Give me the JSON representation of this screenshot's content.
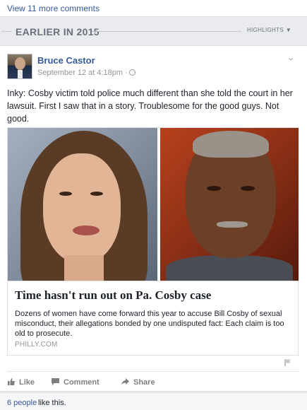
{
  "comments": {
    "view_more_label": "View 11 more comments"
  },
  "section": {
    "title": "EARLIER IN 2015",
    "highlights_label": "HIGHLIGHTS",
    "highlights_caret": "▼"
  },
  "post": {
    "author": "Bruce Castor",
    "timestamp": "September 12 at 4:18pm ·",
    "privacy_icon": "globe-icon",
    "menu_icon": "chevron-down-icon",
    "text": "Inky: Cosby victim told police much different than she told the court in her lawsuit. First I saw that in a story. Troublesome for the good guys. Not good.",
    "link": {
      "title": "Time hasn't run out on Pa. Cosby case",
      "description": "Dozens of women have come forward this year to accuse Bill Cosby of sexual misconduct, their allegations bonded by one undisputed fact: Each claim is too old to prosecute.",
      "source": "PHILLY.COM"
    }
  },
  "actions": {
    "like": "Like",
    "comment": "Comment",
    "share": "Share"
  },
  "likes": {
    "count": "6 people",
    "suffix": "like this."
  },
  "colors": {
    "link": "#365899",
    "muted": "#90949c",
    "background": "#e9ebee",
    "card": "#ffffff"
  }
}
